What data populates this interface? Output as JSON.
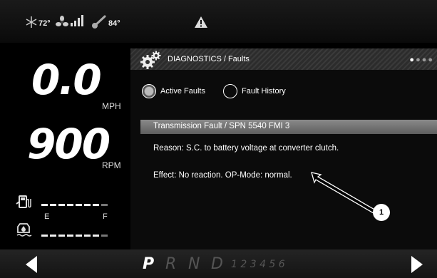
{
  "status": {
    "ambient_temp": "72°",
    "engine_temp": "84°",
    "icons": [
      "snowflake-icon",
      "fan-icon",
      "signal-icon",
      "thermometer-icon",
      "warning-icon"
    ]
  },
  "gauges": {
    "speed_value": "0.0",
    "speed_unit": "MPH",
    "rpm_value": "900",
    "rpm_unit": "RPM",
    "fuel_empty_label": "E",
    "fuel_full_label": "F"
  },
  "diagnostics": {
    "title": "DIAGNOSTICS / Faults",
    "tabs": [
      {
        "label": "Active Faults",
        "selected": true
      },
      {
        "label": "Fault History",
        "selected": false
      }
    ],
    "fault": {
      "title": "Transmission Fault / SPN 5540 FMI 3",
      "reason": "Reason: S.C. to battery voltage at converter clutch.",
      "effect": "Effect: No reaction. OP-Mode: normal."
    },
    "callout": "1"
  },
  "gear_selector": {
    "gears": [
      "P",
      "R",
      "N",
      "D"
    ],
    "active_gear": "P",
    "ranges": "1 2 3 4 5 6"
  },
  "colors": {
    "background": "#000000",
    "panel": "#0b0b0b",
    "fault_bar": "#6f6f6f"
  }
}
